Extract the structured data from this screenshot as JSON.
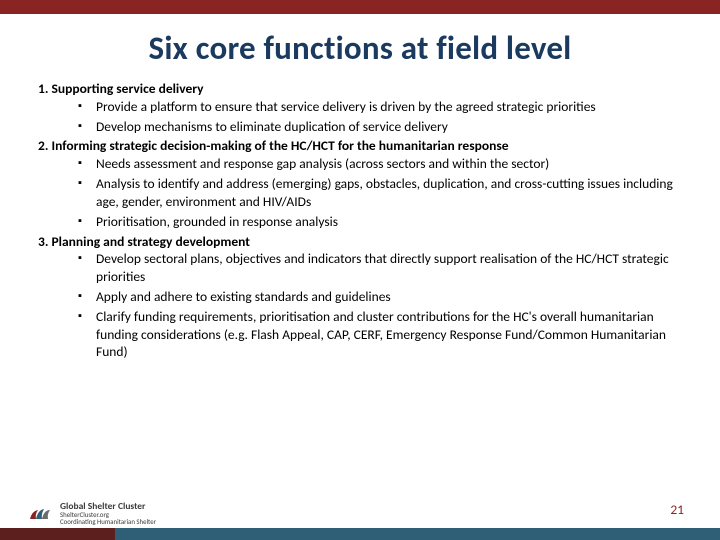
{
  "title": "Six core functions at field level",
  "sections": [
    {
      "heading": "1. Supporting service delivery",
      "bullets": [
        "Provide a platform to ensure that service delivery is driven by the agreed strategic priorities",
        "Develop mechanisms to eliminate duplication of service delivery"
      ]
    },
    {
      "heading": "2. Informing strategic decision-making of the HC/HCT for the humanitarian response",
      "bullets": [
        "Needs assessment and response gap analysis (across sectors and within the sector)",
        "Analysis to identify and address (emerging) gaps, obstacles, duplication, and cross-cutting issues including age, gender, environment and HIV/AIDs",
        "Prioritisation, grounded in response analysis"
      ]
    },
    {
      "heading": "3. Planning and strategy development",
      "bullets": [
        "Develop sectoral plans, objectives and indicators that directly support realisation of the HC/HCT strategic priorities",
        "Apply and adhere to existing standards and guidelines",
        "Clarify funding requirements, prioritisation and cluster contributions for the HC's overall humanitarian funding considerations (e.g. Flash Appeal, CAP, CERF, Emergency Response Fund/Common Humanitarian Fund)"
      ]
    }
  ],
  "footer": {
    "org": "Global Shelter Cluster",
    "url": "ShelterCluster.org",
    "tagline": "Coordinating Humanitarian Shelter"
  },
  "page_number": "21",
  "colors": {
    "top_bar": "#8a2423",
    "title": "#1a3a5f",
    "footer_strip_left": "#5d1f1e",
    "footer_strip_right": "#2e5f77"
  }
}
